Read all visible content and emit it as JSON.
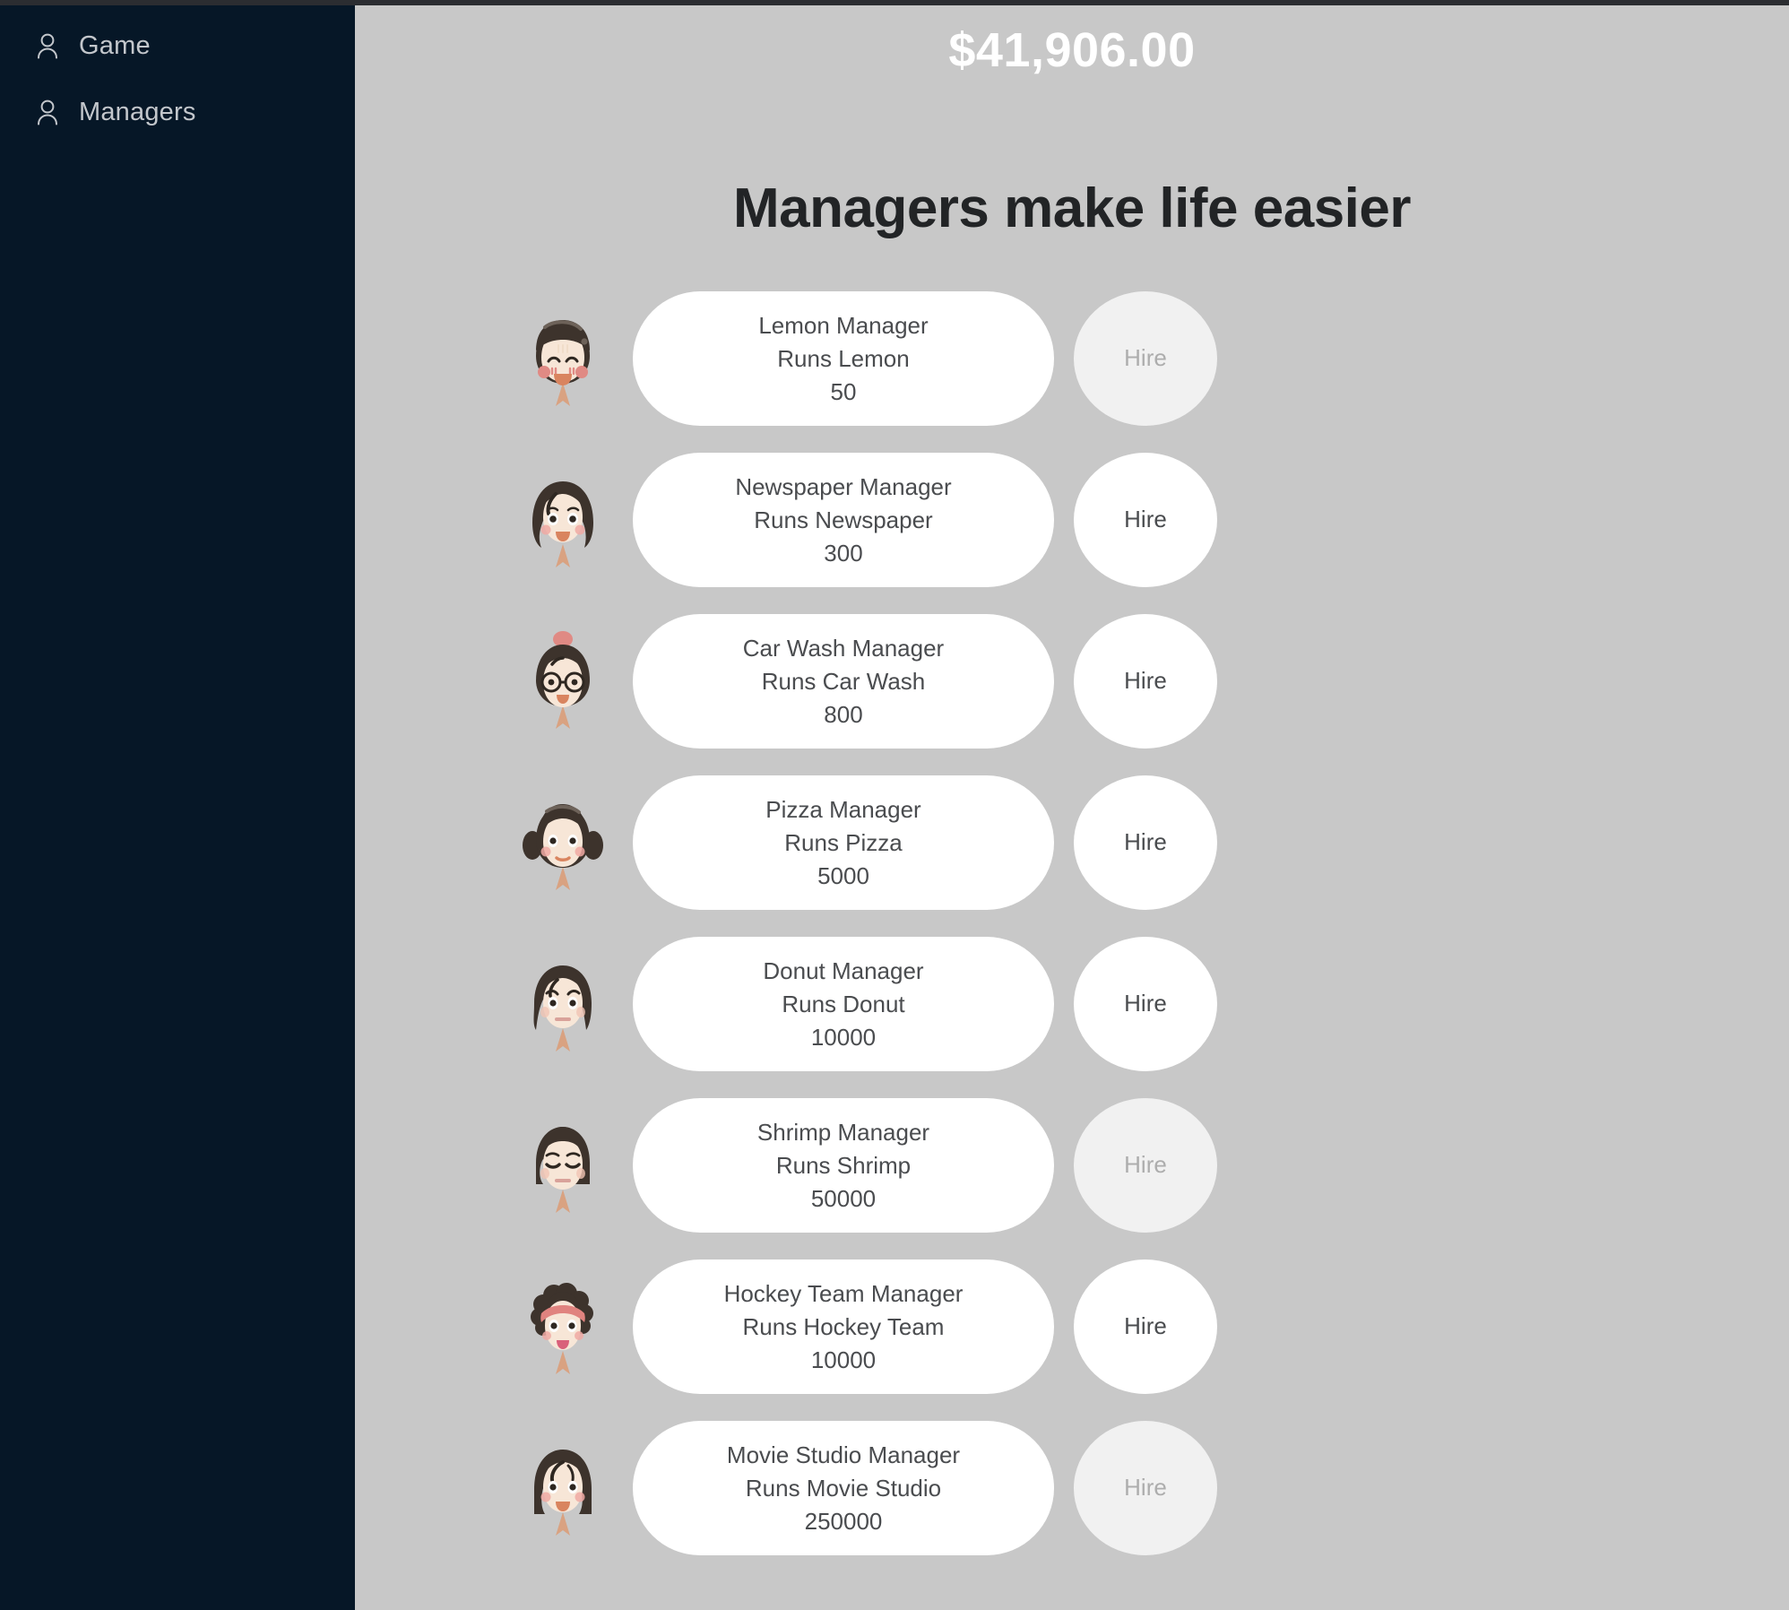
{
  "sidebar": {
    "items": [
      {
        "label": "Game",
        "icon": "person-icon"
      },
      {
        "label": "Managers",
        "icon": "person-icon"
      }
    ]
  },
  "main": {
    "money": "$41,906.00",
    "title": "Managers make life easier",
    "hire_label": "Hire",
    "managers": [
      {
        "name": "Lemon Manager",
        "runs": "Runs Lemon",
        "cost": "50",
        "hire_label": "Hire",
        "enabled": false,
        "avatar": "avatar-bob-bangs-blush"
      },
      {
        "name": "Newspaper Manager",
        "runs": "Runs Newspaper",
        "cost": "300",
        "hire_label": "Hire",
        "enabled": true,
        "avatar": "avatar-wavy-long"
      },
      {
        "name": "Car Wash Manager",
        "runs": "Runs Car Wash",
        "cost": "800",
        "hire_label": "Hire",
        "enabled": true,
        "avatar": "avatar-bun-glasses"
      },
      {
        "name": "Pizza Manager",
        "runs": "Runs Pizza",
        "cost": "5000",
        "hire_label": "Hire",
        "enabled": true,
        "avatar": "avatar-pigtails"
      },
      {
        "name": "Donut Manager",
        "runs": "Runs Donut",
        "cost": "10000",
        "hire_label": "Hire",
        "enabled": true,
        "avatar": "avatar-straight-frown"
      },
      {
        "name": "Shrimp Manager",
        "runs": "Runs Shrimp",
        "cost": "50000",
        "hire_label": "Hire",
        "enabled": false,
        "avatar": "avatar-bob-closed-eyes"
      },
      {
        "name": "Hockey Team Manager",
        "runs": "Runs Hockey Team",
        "cost": "10000",
        "hire_label": "Hire",
        "enabled": true,
        "avatar": "avatar-curly-headband"
      },
      {
        "name": "Movie Studio Manager",
        "runs": "Runs Movie Studio",
        "cost": "250000",
        "hire_label": "Hire",
        "enabled": false,
        "avatar": "avatar-long-side-bangs"
      }
    ]
  },
  "colors": {
    "sidebar_bg": "#061727",
    "sidebar_text": "#c3c7cc",
    "main_bg": "#c8c8c8",
    "card_bg": "#ffffff",
    "card_text": "#4a4c4f",
    "money_text": "#ffffff",
    "title_text": "#222426",
    "hire_disabled_bg": "#f1f1f1",
    "hire_disabled_text": "#adadad",
    "hair_dark": "#3d332c",
    "skin": "#f7e6d7",
    "blush": "#e08a84"
  }
}
